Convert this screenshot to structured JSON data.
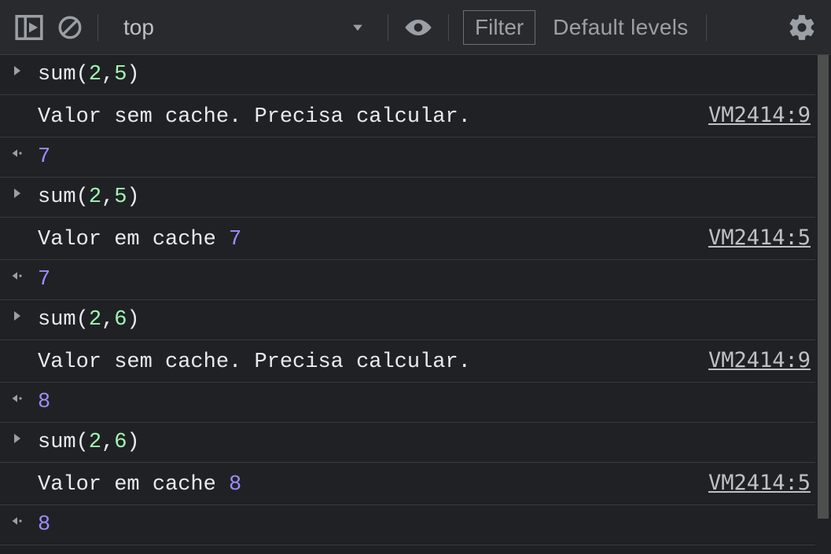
{
  "toolbar": {
    "context_label": "top",
    "filter_placeholder": "Filter",
    "level_label": "Default levels"
  },
  "rows": [
    {
      "type": "input",
      "fn": "sum",
      "args": [
        "2",
        "5"
      ]
    },
    {
      "type": "log",
      "text": "Valor sem cache. Precisa calcular.",
      "value": null,
      "source": "VM2414:9"
    },
    {
      "type": "result",
      "value": "7"
    },
    {
      "type": "input",
      "fn": "sum",
      "args": [
        "2",
        "5"
      ]
    },
    {
      "type": "log",
      "text": "Valor em cache ",
      "value": "7",
      "source": "VM2414:5"
    },
    {
      "type": "result",
      "value": "7"
    },
    {
      "type": "input",
      "fn": "sum",
      "args": [
        "2",
        "6"
      ]
    },
    {
      "type": "log",
      "text": "Valor sem cache. Precisa calcular.",
      "value": null,
      "source": "VM2414:9"
    },
    {
      "type": "result",
      "value": "8"
    },
    {
      "type": "input",
      "fn": "sum",
      "args": [
        "2",
        "6"
      ]
    },
    {
      "type": "log",
      "text": "Valor em cache ",
      "value": "8",
      "source": "VM2414:5"
    },
    {
      "type": "result",
      "value": "8"
    }
  ]
}
